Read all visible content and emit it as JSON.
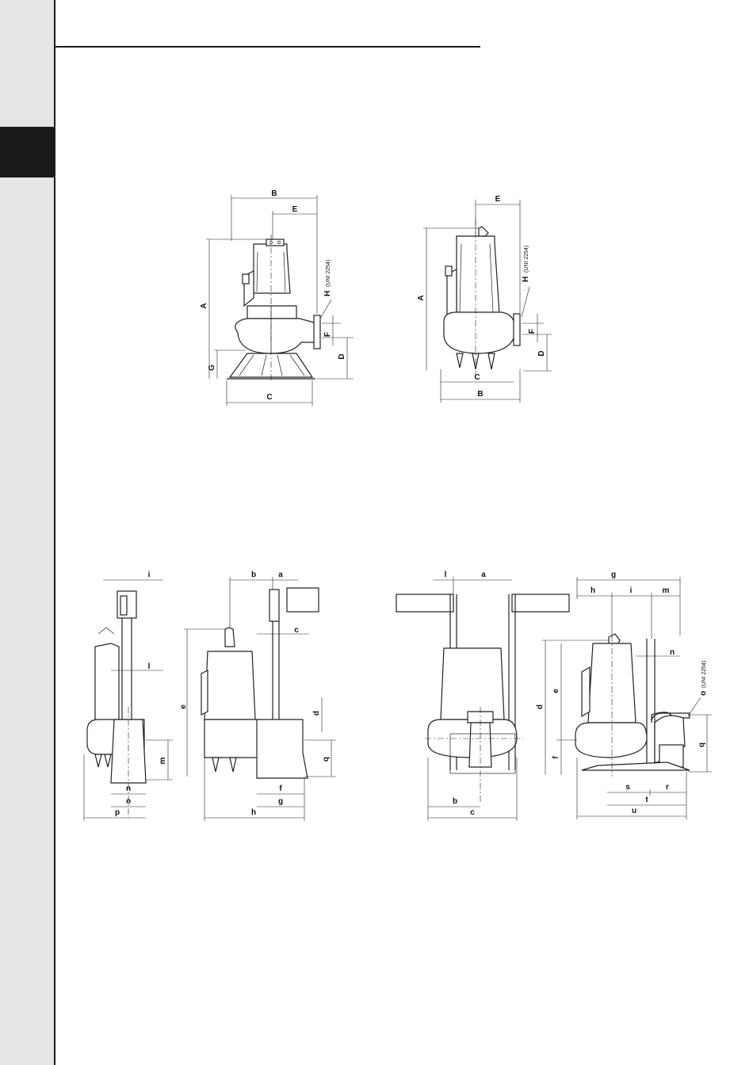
{
  "colors": {
    "sidebar": "#e6e6e8",
    "ink": "#1a1a1a"
  },
  "fig1": {
    "B": "B",
    "E": "E",
    "A": "A",
    "H": "H",
    "UNI": "(UNI 2254)",
    "F": "F",
    "D": "D",
    "G": "G",
    "C": "C"
  },
  "fig2": {
    "E": "E",
    "A": "A",
    "H": "H",
    "UNI": "(UNI 2254)",
    "F": "F",
    "D": "D",
    "C": "C",
    "B": "B"
  },
  "fig3": {
    "i": "i",
    "l": "l",
    "m": "m",
    "n": "n",
    "o": "o",
    "p": "p"
  },
  "fig4": {
    "b": "b",
    "a": "a",
    "c": "c",
    "e": "e",
    "d": "d",
    "q": "q",
    "f": "f",
    "g": "g",
    "h": "h"
  },
  "fig5": {
    "l": "l",
    "a": "a",
    "b": "b",
    "c": "c"
  },
  "fig6": {
    "g": "g",
    "h": "h",
    "i": "i",
    "m": "m",
    "n": "n",
    "o": "o",
    "UNI": "(UNI 2254)",
    "d": "d",
    "e": "e",
    "f": "f",
    "q": "q",
    "s": "s",
    "r": "r",
    "t": "t",
    "u": "u"
  }
}
